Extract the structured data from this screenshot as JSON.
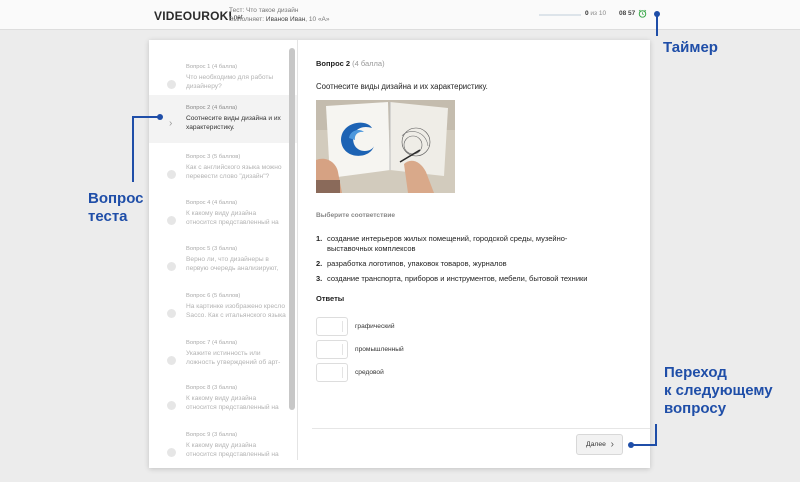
{
  "header": {
    "logo": "VIDEOUROKI",
    "logo_tld": ".net",
    "test_line": "Тест: Что такое дизайн",
    "performer_prefix": "Выполняет:",
    "performer_name": "Иванов Иван",
    "performer_class": ", 10 «А»",
    "progress_done": "0",
    "progress_rest": " из 10",
    "progress_fraction": 0.0,
    "timer": "08 57",
    "alarm_icon": "alarm-clock-icon",
    "accent_color": "#1f4ea8"
  },
  "sidebar": {
    "items": [
      {
        "score": "Вопрос 1 (4 балла)",
        "text": "Что необходимо для работы дизайнеру?"
      },
      {
        "score": "Вопрос 2 (4 балла)",
        "text": "Соотнесите виды дизайна и их характеристику."
      },
      {
        "score": "Вопрос 3 (5 баллов)",
        "text": "Как с английского языка можно перевести слово \"дизайн\"?"
      },
      {
        "score": "Вопрос 4 (4 балла)",
        "text": "К какому виду дизайна относится представленный на"
      },
      {
        "score": "Вопрос 5 (3 балла)",
        "text": "Верно ли, что дизайнеры в первую очередь анализируют,"
      },
      {
        "score": "Вопрос 6 (5 баллов)",
        "text": "На картинке изображено кресло Sacco. Как с итальянского языка"
      },
      {
        "score": "Вопрос 7 (4 балла)",
        "text": "Укажите истинность или ложность утверждений об арт-"
      },
      {
        "score": "Вопрос 8 (3 балла)",
        "text": "К какому виду дизайна относится представленный на"
      },
      {
        "score": "Вопрос 9 (3 балла)",
        "text": "К какому виду дизайна относится представленный на"
      }
    ]
  },
  "question": {
    "number": "Вопрос 2",
    "points": "(4 балла)",
    "title": "Соотнесите виды дизайна и их характеристику.",
    "match_label": "Выберите соответствие",
    "options": [
      {
        "num": "1.",
        "text": "создание интерьеров жилых помещений, городской среды, музейно-выставочных комплексов"
      },
      {
        "num": "2.",
        "text": "разработка логотипов, упаковок товаров, журналов"
      },
      {
        "num": "3.",
        "text": "создание транспорта, приборов и инструментов, мебели, бытовой техники"
      }
    ],
    "answers_label": "Ответы",
    "answers": [
      "графический",
      "промышленный",
      "средовой"
    ],
    "next_label": "Далее"
  },
  "callouts": {
    "timer": "Таймер",
    "question_line1": "Вопрос",
    "question_line2": "теста",
    "next_line1": "Переход",
    "next_line2": "к следующему",
    "next_line3": "вопросу"
  }
}
